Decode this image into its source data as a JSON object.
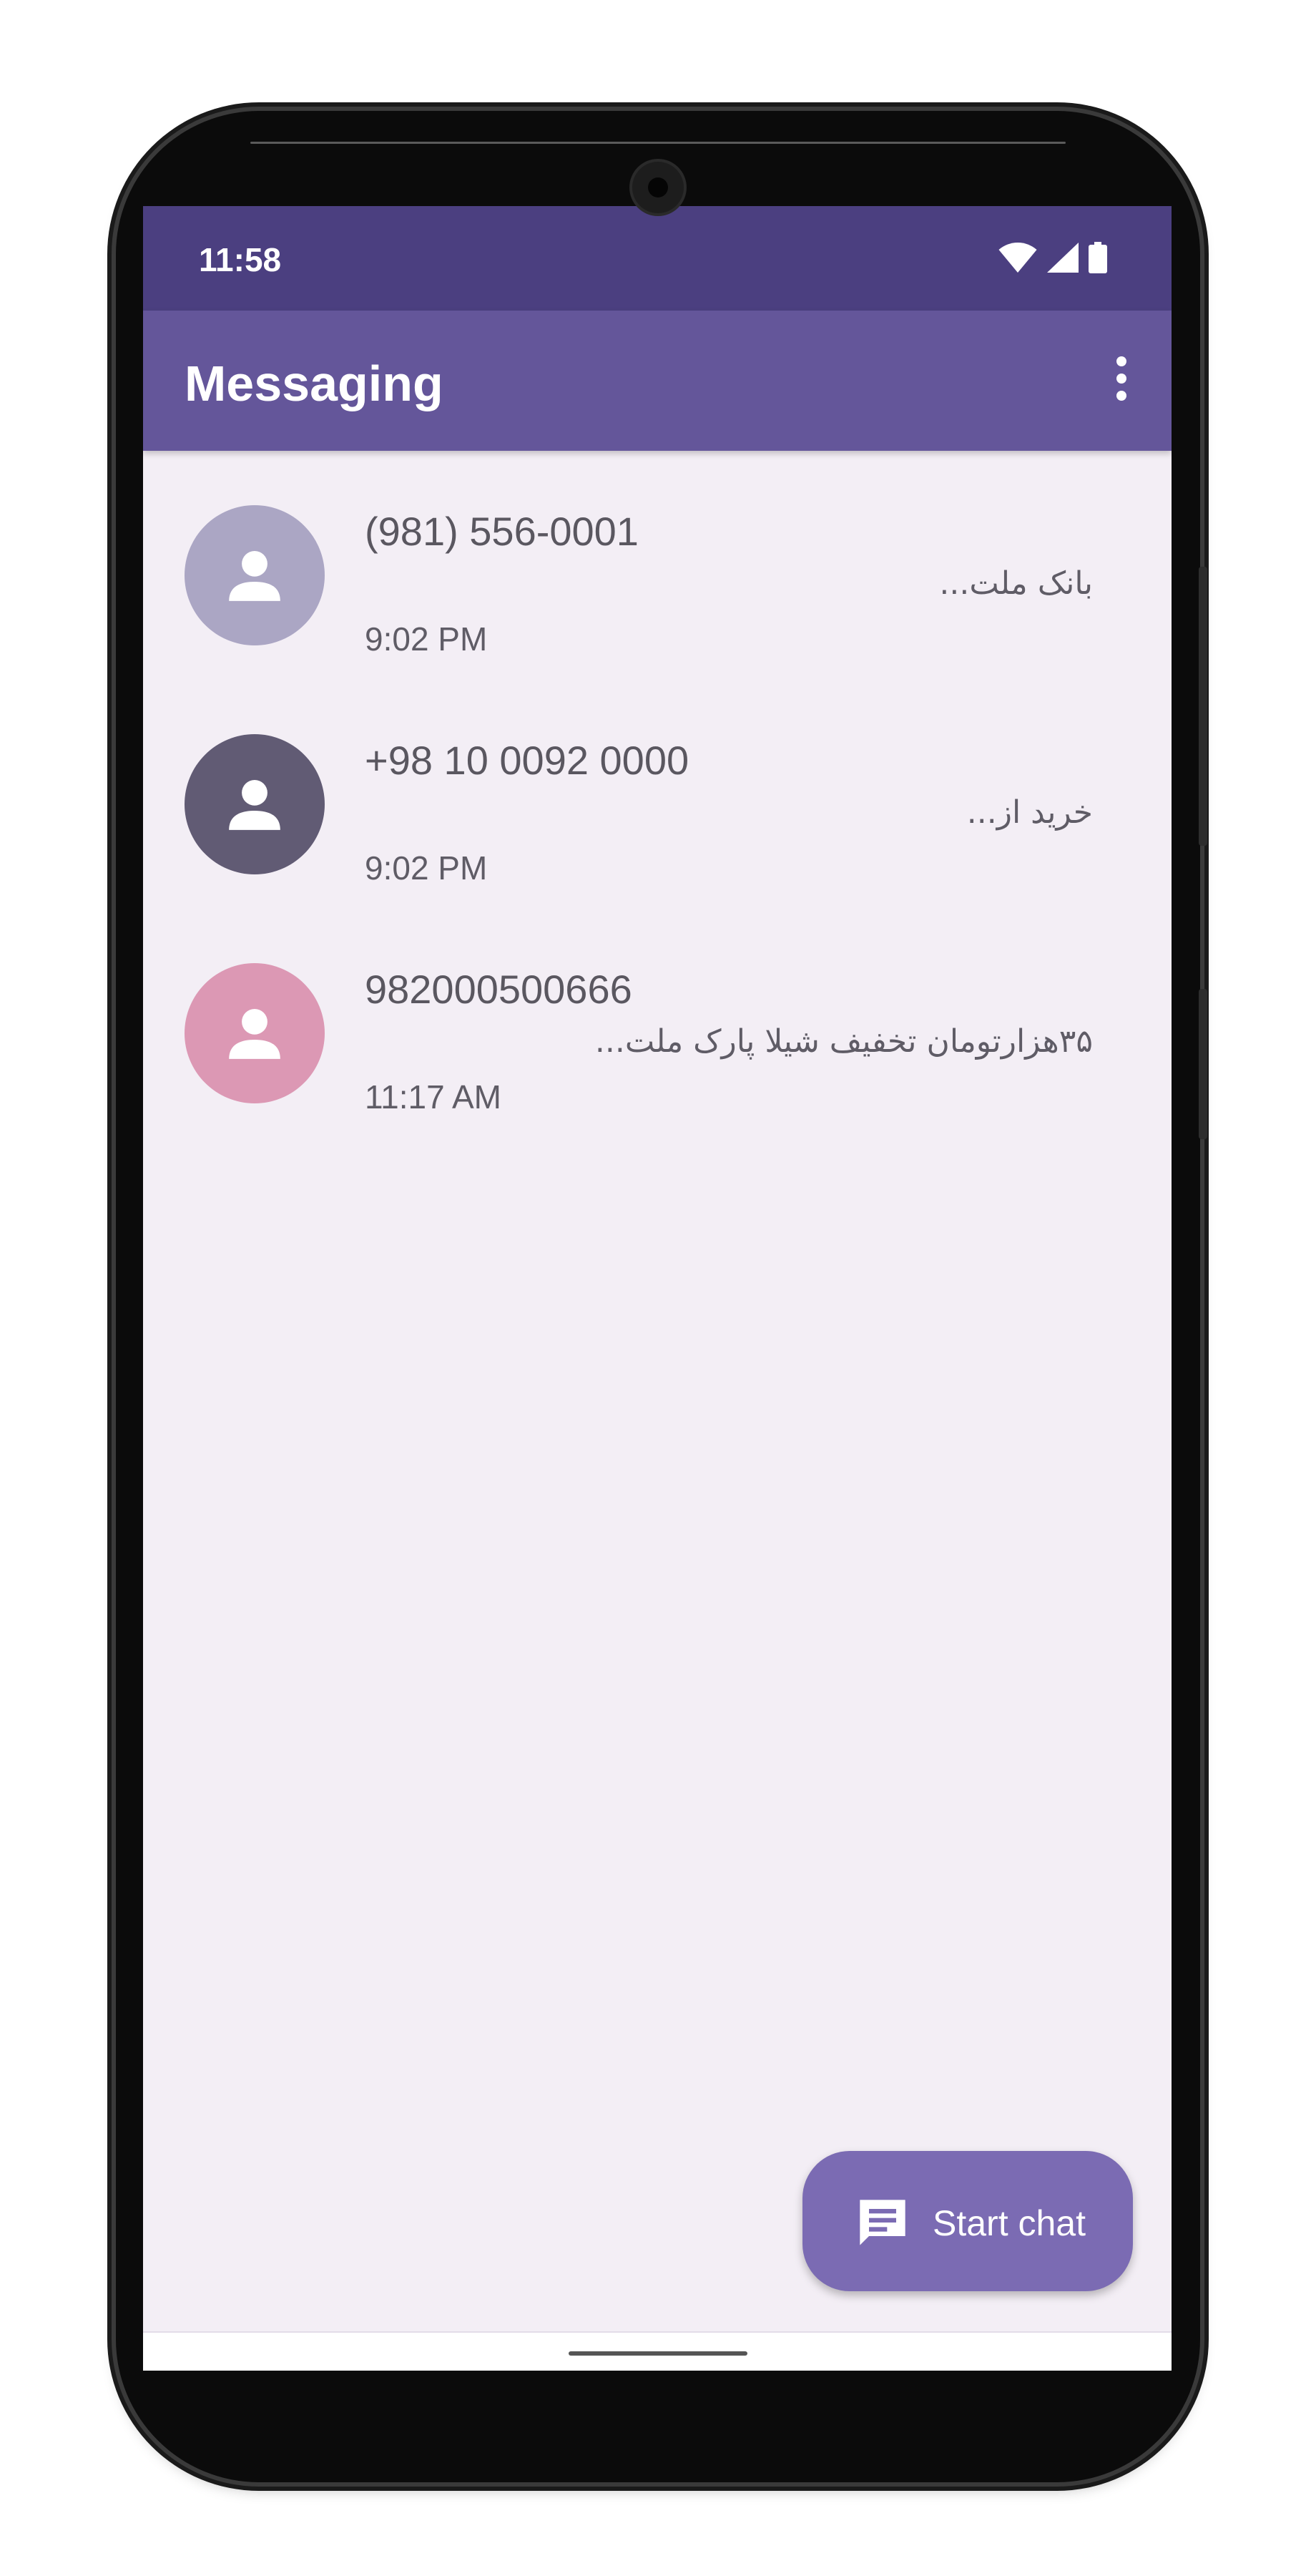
{
  "status_bar": {
    "time": "11:58",
    "icons": [
      "wifi-icon",
      "cellular-signal-icon",
      "battery-icon"
    ]
  },
  "app_bar": {
    "title": "Messaging",
    "overflow_icon": "more-vert-icon"
  },
  "conversations": [
    {
      "sender": "(981) 556-0001",
      "preview": "بانک ملت...",
      "time": "9:02 PM",
      "avatar_color": "#aba6c4"
    },
    {
      "sender": "+98 10 0092 0000",
      "preview": "خرید از...",
      "time": "9:02 PM",
      "avatar_color": "#615b74"
    },
    {
      "sender": "982000500666",
      "preview": "۳۵هزارتومان تخفیف شیلا پارک ملت...",
      "time": "11:17 AM",
      "avatar_color": "#dc98b4"
    }
  ],
  "fab": {
    "label": "Start chat",
    "icon": "chat-icon"
  },
  "colors": {
    "status_bar": "#4b3f80",
    "app_bar": "#64569a",
    "fab": "#7b6bb3",
    "background": "#f3eef5"
  }
}
